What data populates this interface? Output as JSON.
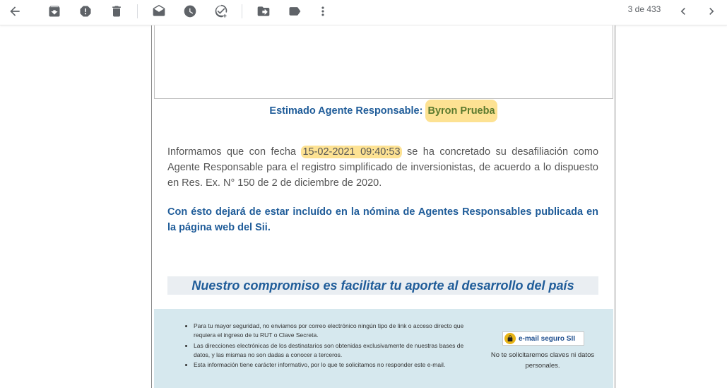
{
  "toolbar": {
    "icons": [
      "back-arrow-icon",
      "archive-icon",
      "report-spam-icon",
      "delete-icon",
      "mark-unread-icon",
      "snooze-icon",
      "add-to-tasks-icon",
      "move-to-icon",
      "label-icon",
      "more-vert-icon",
      "chevron-left-icon",
      "chevron-right-icon"
    ],
    "counter": "3 de 433"
  },
  "email": {
    "greeting_label": "Estimado Agente Responsable:",
    "greeting_name": "Byron Prueba",
    "body_prefix": "Informamos que con fecha",
    "body_date": "15-02-2021 09:40:53",
    "body_suffix": "se ha concretado su desafiliación como Agente Responsable para el registro simplificado de inversionistas, de acuerdo a lo dispuesto en Res. Ex. N° 150 de 2 de diciembre de 2020.",
    "bold_notice": "Con ésto dejará de estar incluído en la nómina de Agentes Responsables publicada en la página web del Sii.",
    "banner": "Nuestro compromiso es facilitar tu aporte al desarrollo del país",
    "footer": {
      "bullets": [
        "Para tu mayor seguridad, no enviamos por correo electrónico ningún tipo de link o acceso directo que requiera el ingreso de tu RUT o Clave Secreta.",
        "Las direcciones electrónicas de los destinatarios son obtenidas exclusivamente de nuestras bases de datos, y las mismas no son dadas a conocer a terceros.",
        "Esta información tiene carácter informativo, por lo que te solicitamos no responder este e-mail."
      ],
      "badge_text": "e-mail seguro SII",
      "badge_caption": "No te solicitaremos claves ni datos personales."
    }
  },
  "colors": {
    "accent_blue": "#1f5c99",
    "highlight": "#fde293",
    "footer_bg": "#d6e8ee"
  }
}
